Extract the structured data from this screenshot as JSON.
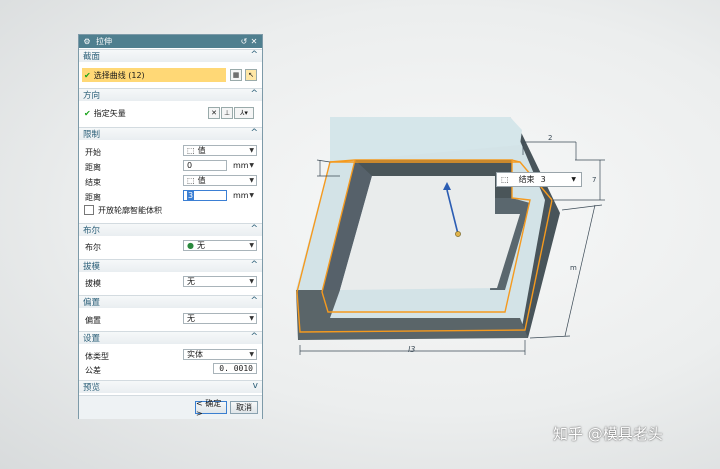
{
  "dialog": {
    "title": "拉伸",
    "sections": {
      "section": {
        "label": "截面",
        "select_curve": "选择曲线 (12)"
      },
      "direction": {
        "label": "方向",
        "specify_vector": "指定矢量"
      },
      "limits": {
        "label": "限制",
        "start_label": "开始",
        "start_value": "值",
        "distance1_label": "距离",
        "distance1_value": "0",
        "distance1_unit": "mm",
        "end_label": "结束",
        "end_value": "值",
        "distance2_label": "距离",
        "distance2_value": "3",
        "distance2_unit": "mm",
        "open_profile_label": "开放轮廓智能体积"
      },
      "boolean": {
        "label": "布尔",
        "field_label": "布尔",
        "value": "无"
      },
      "draft": {
        "label": "拔模",
        "field_label": "拔模",
        "value": "无"
      },
      "offset": {
        "label": "偏置",
        "field_label": "偏置",
        "value": "无"
      },
      "settings": {
        "label": "设置",
        "body_type_label": "体类型",
        "body_type_value": "实体",
        "tolerance_label": "公差",
        "tolerance_value": "0. 0010"
      },
      "preview": {
        "label": "预览"
      }
    },
    "buttons": {
      "ok": "< 确定 >",
      "cancel": "取消"
    }
  },
  "viewport": {
    "end_popup_label": "结束",
    "end_popup_value": "3",
    "dimension_label": "l3"
  },
  "watermark": "知乎 @模具老头",
  "colors": {
    "titlebar": "#4f7f8f",
    "highlight": "#ffd876",
    "edge": "#f59a1e",
    "face_light": "#c8dce2",
    "face_dark": "#4a5559"
  }
}
